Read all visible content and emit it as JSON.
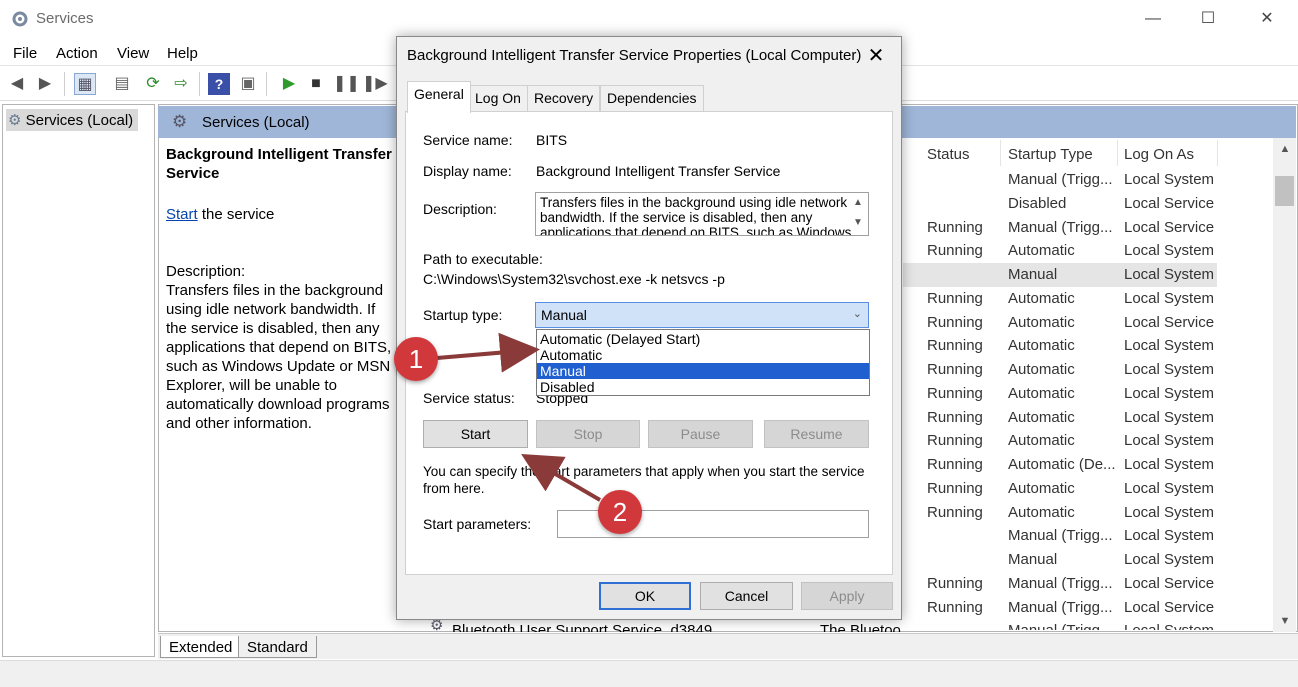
{
  "window": {
    "title": "Services",
    "controls": {
      "minimize": "—",
      "maximize": "☐",
      "close": "✕"
    }
  },
  "menu": {
    "file": "File",
    "action": "Action",
    "view": "View",
    "help": "Help"
  },
  "toolbar_icons": [
    "back-icon",
    "forward-icon",
    "show-hide-tree-icon",
    "properties-icon",
    "refresh-icon",
    "export-icon",
    "help-icon",
    "view-icon",
    "play-icon",
    "stop-icon",
    "pause-icon",
    "resume-icon"
  ],
  "tree": {
    "root": "Services (Local)"
  },
  "pane": {
    "header": "Services (Local)",
    "extended": {
      "service_name": "Background Intelligent Transfer Service",
      "start_link": "Start",
      "start_suffix": " the service",
      "description_label": "Description:",
      "description": "Transfers files in the background using idle network bandwidth. If the service is disabled, then any applications that depend on BITS, such as Windows Update or MSN Explorer, will be unable to automatically download programs and other information."
    },
    "columns": {
      "status": "Status",
      "startup_type": "Startup Type",
      "log_on_as": "Log On As"
    },
    "rows": [
      {
        "status": "",
        "startup": "Manual (Trigg...",
        "logon": "Local System"
      },
      {
        "status": "",
        "startup": "Disabled",
        "logon": "Local Service"
      },
      {
        "status": "Running",
        "startup": "Manual (Trigg...",
        "logon": "Local Service"
      },
      {
        "status": "Running",
        "startup": "Automatic",
        "logon": "Local System"
      },
      {
        "status": "",
        "startup": "Manual",
        "logon": "Local System"
      },
      {
        "status": "Running",
        "startup": "Automatic",
        "logon": "Local System"
      },
      {
        "status": "Running",
        "startup": "Automatic",
        "logon": "Local Service"
      },
      {
        "status": "Running",
        "startup": "Automatic",
        "logon": "Local System"
      },
      {
        "status": "Running",
        "startup": "Automatic",
        "logon": "Local System"
      },
      {
        "status": "Running",
        "startup": "Automatic",
        "logon": "Local System"
      },
      {
        "status": "Running",
        "startup": "Automatic",
        "logon": "Local System"
      },
      {
        "status": "Running",
        "startup": "Automatic",
        "logon": "Local System"
      },
      {
        "status": "Running",
        "startup": "Automatic (De...",
        "logon": "Local System"
      },
      {
        "status": "Running",
        "startup": "Automatic",
        "logon": "Local System"
      },
      {
        "status": "Running",
        "startup": "Automatic",
        "logon": "Local System"
      },
      {
        "status": "",
        "startup": "Manual (Trigg...",
        "logon": "Local System"
      },
      {
        "status": "",
        "startup": "Manual",
        "logon": "Local System"
      },
      {
        "status": "Running",
        "startup": "Manual (Trigg...",
        "logon": "Local Service"
      },
      {
        "status": "Running",
        "startup": "Manual (Trigg...",
        "logon": "Local Service"
      },
      {
        "status": "",
        "startup": "Manual (Trigg...",
        "logon": "Local System"
      }
    ],
    "partial_row": {
      "name": "Bluetooth User Support Service_d3849",
      "description": "The Bluetoo..."
    },
    "bottom_tabs": {
      "extended": "Extended",
      "standard": "Standard"
    }
  },
  "dialog": {
    "title": "Background Intelligent Transfer Service Properties (Local Computer)",
    "tabs": {
      "general": "General",
      "log_on": "Log On",
      "recovery": "Recovery",
      "dependencies": "Dependencies"
    },
    "service_name_label": "Service name:",
    "service_name": "BITS",
    "display_name_label": "Display name:",
    "display_name": "Background Intelligent Transfer Service",
    "description_label": "Description:",
    "description": "Transfers files in the background using idle network bandwidth. If the service is disabled, then any applications that depend on BITS, such as Windows",
    "path_label": "Path to executable:",
    "path": "C:\\Windows\\System32\\svchost.exe -k netsvcs -p",
    "startup_type_label": "Startup type:",
    "startup_type_value": "Manual",
    "startup_options": [
      "Automatic (Delayed Start)",
      "Automatic",
      "Manual",
      "Disabled"
    ],
    "service_status_label": "Service status:",
    "service_status": "Stopped",
    "buttons": {
      "start": "Start",
      "stop": "Stop",
      "pause": "Pause",
      "resume": "Resume"
    },
    "hint": "You can specify the start parameters that apply when you start the service from here.",
    "start_params_label": "Start parameters:",
    "start_params_value": "",
    "footer": {
      "ok": "OK",
      "cancel": "Cancel",
      "apply": "Apply"
    }
  },
  "annotations": {
    "badge1": "1",
    "badge2": "2",
    "color": "#d1383b",
    "arrow_color": "#8b3a3a"
  },
  "colors": {
    "pane_header": "#9fb6d8",
    "selection": "#1f5fcf",
    "select_bg": "#cfe2f7"
  }
}
